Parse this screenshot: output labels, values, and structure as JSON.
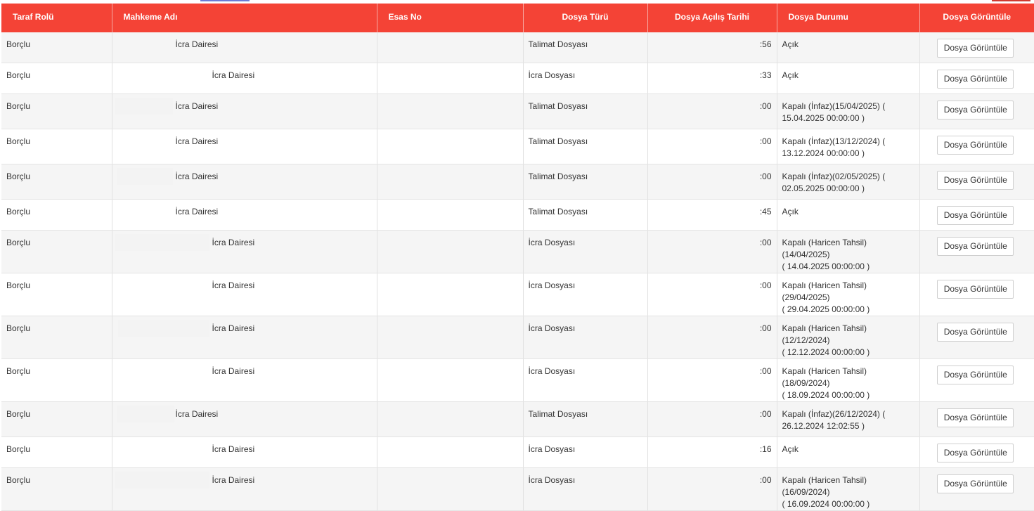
{
  "table": {
    "headers": {
      "role": "Taraf Rolü",
      "court": "Mahkeme Adı",
      "esas": "Esas No",
      "type": "Dosya Türü",
      "date": "Dosya Açılış Tarihi",
      "status": "Dosya Durumu",
      "view": "Dosya Görüntüle"
    },
    "rows": [
      {
        "role": "Borçlu",
        "court": "İcra Dairesi",
        "esas": "",
        "type": "Talimat Dosyası",
        "date": ":56",
        "status": [
          "Açık"
        ],
        "button": "Dosya Görüntüle"
      },
      {
        "role": "Borçlu",
        "court": "İcra Dairesi",
        "esas": "",
        "type": "İcra Dosyası",
        "date": ":33",
        "status": [
          "Açık"
        ],
        "button": "Dosya Görüntüle"
      },
      {
        "role": "Borçlu",
        "court": "İcra Dairesi",
        "esas": "",
        "type": "Talimat Dosyası",
        "date": ":00",
        "status": [
          "Kapalı (İnfaz)(15/04/2025) (",
          "15.04.2025 00:00:00 )"
        ],
        "button": "Dosya Görüntüle"
      },
      {
        "role": "Borçlu",
        "court": "İcra Dairesi",
        "esas": "",
        "type": "Talimat Dosyası",
        "date": ":00",
        "status": [
          "Kapalı (İnfaz)(13/12/2024) (",
          "13.12.2024 00:00:00 )"
        ],
        "button": "Dosya Görüntüle"
      },
      {
        "role": "Borçlu",
        "court": "İcra Dairesi",
        "esas": "",
        "type": "Talimat Dosyası",
        "date": ":00",
        "status": [
          "Kapalı (İnfaz)(02/05/2025) (",
          "02.05.2025 00:00:00 )"
        ],
        "button": "Dosya Görüntüle"
      },
      {
        "role": "Borçlu",
        "court": "İcra Dairesi",
        "esas": "",
        "type": "Talimat Dosyası",
        "date": ":45",
        "status": [
          "Açık"
        ],
        "button": "Dosya Görüntüle"
      },
      {
        "role": "Borçlu",
        "court": "İcra Dairesi",
        "esas": "",
        "type": "İcra Dosyası",
        "date": ":00",
        "status": [
          "Kapalı (Haricen Tahsil)(14/04/2025)",
          "( 14.04.2025 00:00:00 )"
        ],
        "button": "Dosya Görüntüle"
      },
      {
        "role": "Borçlu",
        "court": "İcra Dairesi",
        "esas": "",
        "type": "İcra Dosyası",
        "date": ":00",
        "status": [
          "Kapalı (Haricen Tahsil)(29/04/2025)",
          "( 29.04.2025 00:00:00 )"
        ],
        "button": "Dosya Görüntüle"
      },
      {
        "role": "Borçlu",
        "court": "İcra Dairesi",
        "esas": "",
        "type": "İcra Dosyası",
        "date": ":00",
        "status": [
          "Kapalı (Haricen Tahsil)(12/12/2024)",
          "( 12.12.2024 00:00:00 )"
        ],
        "button": "Dosya Görüntüle"
      },
      {
        "role": "Borçlu",
        "court": "İcra Dairesi",
        "esas": "",
        "type": "İcra Dosyası",
        "date": ":00",
        "status": [
          "Kapalı (Haricen Tahsil)(18/09/2024)",
          "( 18.09.2024 00:00:00 )"
        ],
        "button": "Dosya Görüntüle"
      },
      {
        "role": "Borçlu",
        "court": "İcra Dairesi",
        "esas": "",
        "type": "Talimat Dosyası",
        "date": ":00",
        "status": [
          "Kapalı (İnfaz)(26/12/2024) (",
          "26.12.2024 12:02:55 )"
        ],
        "button": "Dosya Görüntüle"
      },
      {
        "role": "Borçlu",
        "court": "İcra Dairesi",
        "esas": "",
        "type": "İcra Dosyası",
        "date": ":16",
        "status": [
          "Açık"
        ],
        "button": "Dosya Görüntüle"
      },
      {
        "role": "Borçlu",
        "court": "İcra Dairesi",
        "esas": "",
        "type": "İcra Dosyası",
        "date": ":00",
        "status": [
          "Kapalı (Haricen Tahsil)(16/09/2024)",
          "( 16.09.2024 00:00:00 )"
        ],
        "button": "Dosya Görüntüle"
      }
    ]
  },
  "colors": {
    "header_bg": "#f44336",
    "header_text": "#ffffff",
    "row_alt": "#f5f5f5"
  }
}
